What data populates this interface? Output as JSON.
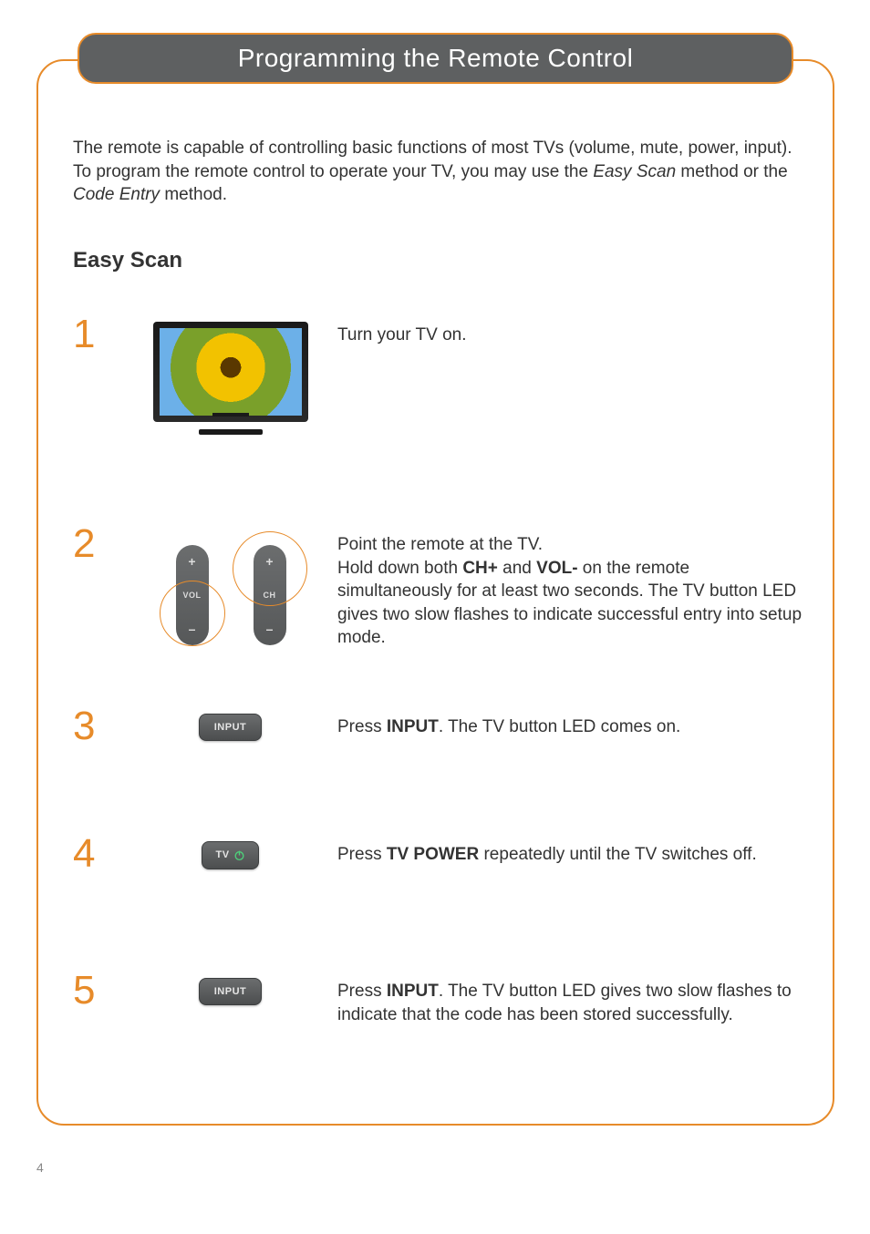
{
  "page_title": "Programming the Remote Control",
  "page_number": "4",
  "intro": {
    "pre": "The remote is capable of controlling basic functions of most TVs (volume, mute, power, input). To program the remote control to operate your TV, you may use the ",
    "method1": "Easy Scan",
    "mid": " method or the ",
    "method2": "Code Entry",
    "post": " method."
  },
  "section_heading": "Easy Scan",
  "steps": {
    "s1": {
      "num": "1",
      "text": "Turn your TV on."
    },
    "s2": {
      "num": "2",
      "line1": "Point the remote at the TV.",
      "line2a": "Hold down both ",
      "chplus": "CH+",
      "line2b": " and ",
      "volminus": "VOL-",
      "line2c": " on the remote simultaneously for at least two seconds. The TV button LED gives two slow flashes to indicate successful entry into setup mode."
    },
    "s3": {
      "num": "3",
      "a": "Press ",
      "input": "INPUT",
      "b": ". The TV button LED comes on."
    },
    "s4": {
      "num": "4",
      "a": "Press ",
      "tvpower": "TV POWER",
      "b": " repeatedly until the TV switches off."
    },
    "s5": {
      "num": "5",
      "a": "Press ",
      "input": "INPUT",
      "b": ". The TV button LED gives two slow flashes to indicate that the code has been stored successfully."
    }
  },
  "buttons": {
    "vol": "VOL",
    "ch": "CH",
    "input": "INPUT",
    "tv": "TV",
    "plus": "+",
    "minus": "–"
  }
}
